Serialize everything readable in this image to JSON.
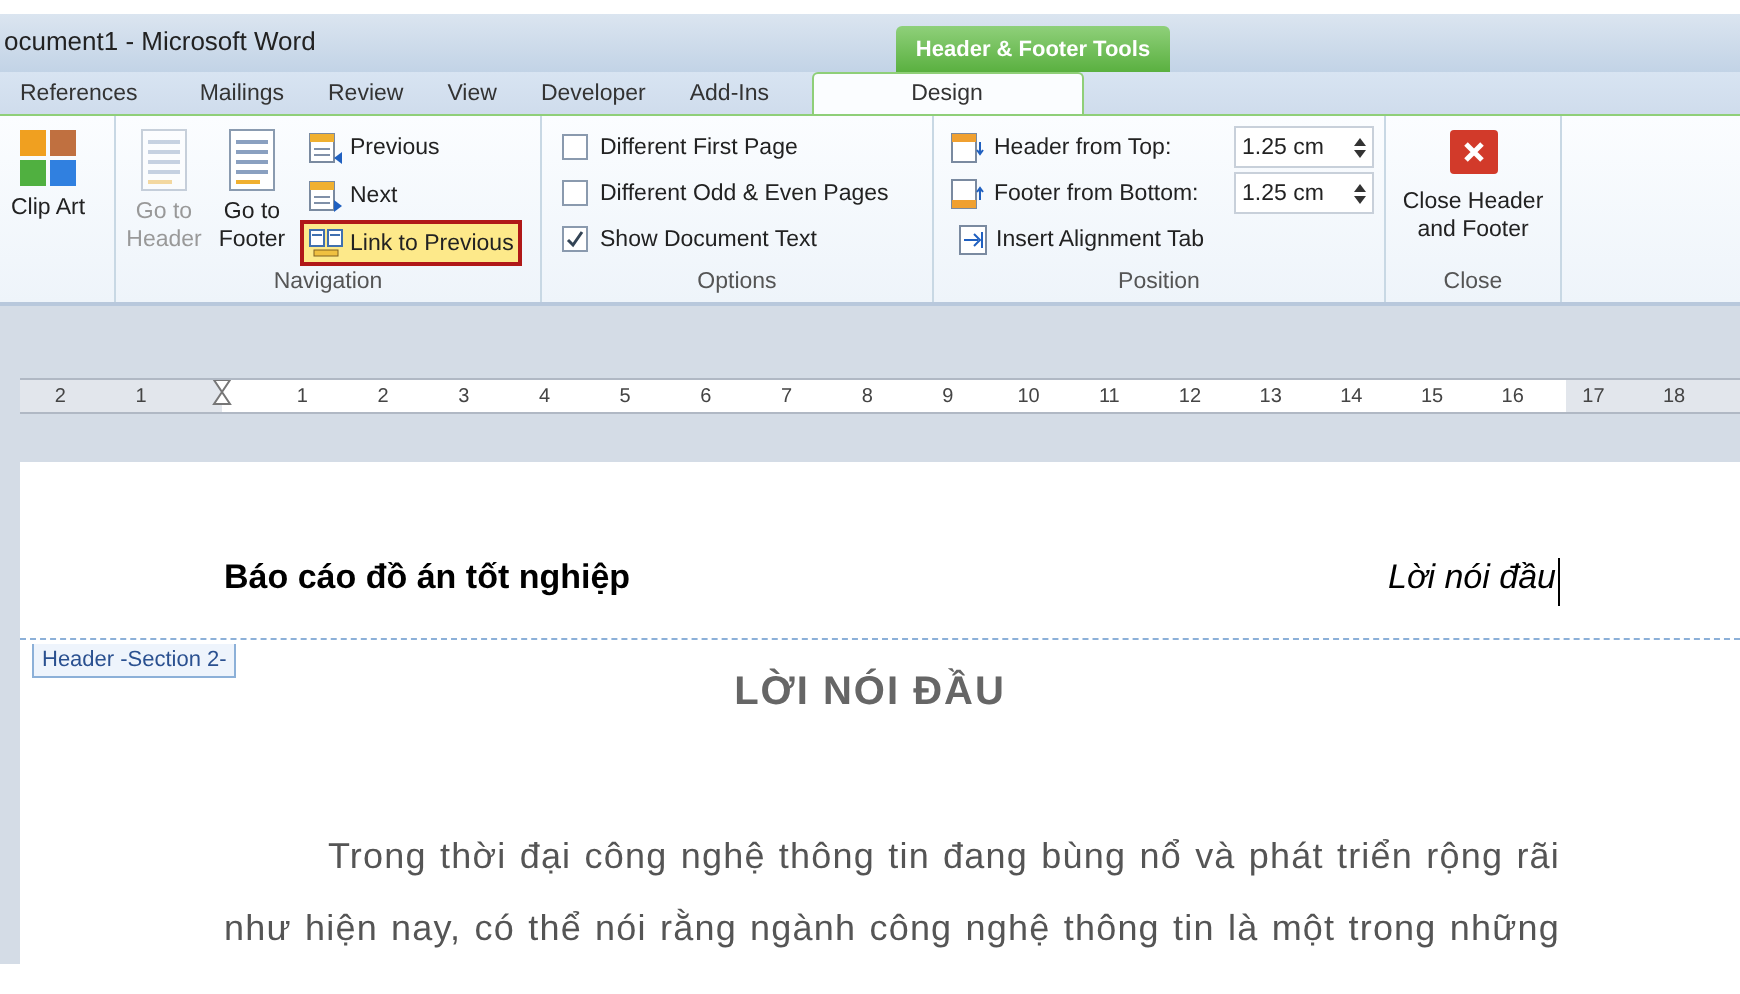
{
  "window": {
    "title": "ocument1 - Microsoft Word"
  },
  "contextual_tab": {
    "label": "Header & Footer Tools"
  },
  "tabs": [
    {
      "label": "References",
      "selected": false
    },
    {
      "label": "Mailings",
      "selected": false
    },
    {
      "label": "Review",
      "selected": false
    },
    {
      "label": "View",
      "selected": false
    },
    {
      "label": "Developer",
      "selected": false
    },
    {
      "label": "Add-Ins",
      "selected": false
    },
    {
      "label": "Design",
      "selected": true
    }
  ],
  "clip_art": {
    "label": "Clip Art"
  },
  "navigation": {
    "label": "Navigation",
    "big_buttons": [
      {
        "label": "Go to Header",
        "disabled": true
      },
      {
        "label": "Go to Footer",
        "disabled": false
      }
    ],
    "small_buttons": [
      {
        "label": "Previous",
        "selected": false
      },
      {
        "label": "Next",
        "selected": false
      },
      {
        "label": "Link to Previous",
        "selected": true
      }
    ]
  },
  "options": {
    "label": "Options",
    "checkboxes": [
      {
        "label": "Different First Page",
        "checked": false
      },
      {
        "label": "Different Odd & Even Pages",
        "checked": false
      },
      {
        "label": "Show Document Text",
        "checked": true
      }
    ]
  },
  "position": {
    "label": "Position",
    "spinners": [
      {
        "label": "Header from Top:",
        "value": "1.25 cm"
      },
      {
        "label": "Footer from Bottom:",
        "value": "1.25 cm"
      }
    ],
    "button": {
      "label": "Insert Alignment Tab"
    }
  },
  "close": {
    "label": "Close",
    "button": {
      "label": "Close Header and Footer"
    }
  },
  "ruler": {
    "left_labels": [
      "2",
      "1"
    ],
    "labels": [
      "1",
      "2",
      "3",
      "4",
      "5",
      "6",
      "7",
      "8",
      "9",
      "10",
      "11",
      "12",
      "13",
      "14",
      "15",
      "16",
      "17",
      "18"
    ]
  },
  "document": {
    "header_left": "Báo cáo đồ án tốt nghiệp",
    "header_right": "Lời nói đầu",
    "header_tag": "Header -Section 2-",
    "heading": "LỜI NÓI ĐẦU",
    "paragraph": "Trong thời đại công nghệ thông tin đang bùng nổ và phát triển rộng rãi như hiện nay, có thể nói rằng ngành công nghệ thông tin là một trong những"
  }
}
